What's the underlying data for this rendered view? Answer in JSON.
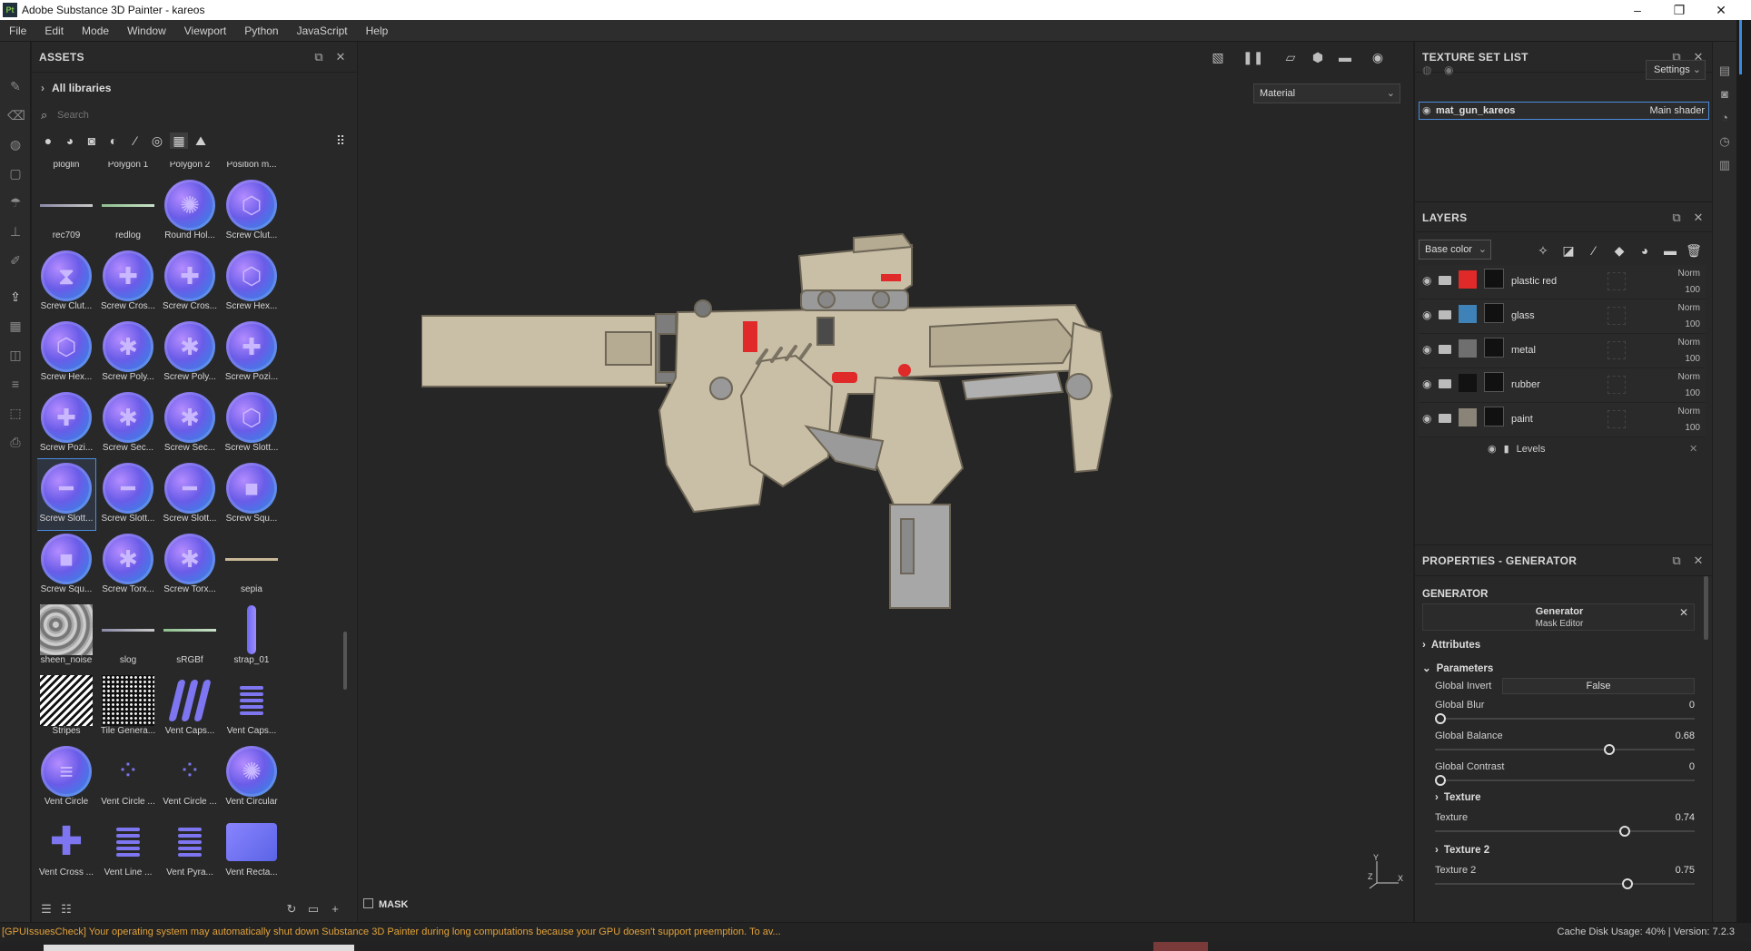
{
  "window": {
    "title": "Adobe Substance 3D Painter - kareos",
    "app_icon": "Pt"
  },
  "menu": [
    "File",
    "Edit",
    "Mode",
    "Window",
    "Viewport",
    "Python",
    "JavaScript",
    "Help"
  ],
  "assets": {
    "title": "ASSETS",
    "library": "All libraries",
    "search_placeholder": "Search",
    "items": [
      {
        "label": "ploglin",
        "thumb": "none"
      },
      {
        "label": "Polygon 1",
        "thumb": "none"
      },
      {
        "label": "Polygon 2",
        "thumb": "none"
      },
      {
        "label": "Position m...",
        "thumb": "none"
      },
      {
        "label": "rec709",
        "thumb": "line-gradient"
      },
      {
        "label": "redlog",
        "thumb": "line-green"
      },
      {
        "label": "Round Hol...",
        "thumb": "disc-gear"
      },
      {
        "label": "Screw Clut...",
        "thumb": "disc-hex"
      },
      {
        "label": "Screw Clut...",
        "thumb": "disc-clutch"
      },
      {
        "label": "Screw Cros...",
        "thumb": "disc-cross"
      },
      {
        "label": "Screw Cros...",
        "thumb": "disc-cross"
      },
      {
        "label": "Screw Hex...",
        "thumb": "disc-hex"
      },
      {
        "label": "Screw Hex...",
        "thumb": "disc-hex"
      },
      {
        "label": "Screw Poly...",
        "thumb": "disc-star"
      },
      {
        "label": "Screw Poly...",
        "thumb": "disc-star"
      },
      {
        "label": "Screw Pozi...",
        "thumb": "disc-cross"
      },
      {
        "label": "Screw Pozi...",
        "thumb": "disc-cross"
      },
      {
        "label": "Screw Sec...",
        "thumb": "disc-star"
      },
      {
        "label": "Screw Sec...",
        "thumb": "disc-star"
      },
      {
        "label": "Screw Slott...",
        "thumb": "disc-hex"
      },
      {
        "label": "Screw Slott...",
        "thumb": "disc-slot",
        "selected": true
      },
      {
        "label": "Screw Slott...",
        "thumb": "disc-slot"
      },
      {
        "label": "Screw Slott...",
        "thumb": "disc-slot"
      },
      {
        "label": "Screw Squ...",
        "thumb": "disc-square"
      },
      {
        "label": "Screw Squ...",
        "thumb": "disc-square"
      },
      {
        "label": "Screw Torx...",
        "thumb": "disc-star"
      },
      {
        "label": "Screw Torx...",
        "thumb": "disc-star"
      },
      {
        "label": "sepia",
        "thumb": "line-sepia"
      },
      {
        "label": "sheen_noise",
        "thumb": "noise"
      },
      {
        "label": "slog",
        "thumb": "line-gradient"
      },
      {
        "label": "sRGBf",
        "thumb": "line-green"
      },
      {
        "label": "strap_01",
        "thumb": "vbar"
      },
      {
        "label": "Stripes",
        "thumb": "stripes"
      },
      {
        "label": "Tile Genera...",
        "thumb": "tiles"
      },
      {
        "label": "Vent Caps...",
        "thumb": "vents"
      },
      {
        "label": "Vent Caps...",
        "thumb": "hlines"
      },
      {
        "label": "Vent Circle",
        "thumb": "disc-lines"
      },
      {
        "label": "Vent Circle ...",
        "thumb": "dots"
      },
      {
        "label": "Vent Circle ...",
        "thumb": "dots"
      },
      {
        "label": "Vent Circular",
        "thumb": "disc-gear"
      },
      {
        "label": "Vent Cross ...",
        "thumb": "cross"
      },
      {
        "label": "Vent Line ...",
        "thumb": "hlines"
      },
      {
        "label": "Vent Pyra...",
        "thumb": "hlines"
      },
      {
        "label": "Vent Recta...",
        "thumb": "rect"
      }
    ]
  },
  "viewport": {
    "material_mode": "Material",
    "mask_label": "MASK",
    "axis": {
      "y": "Y",
      "z": "Z",
      "x": "X"
    }
  },
  "texture_set_list": {
    "title": "TEXTURE SET LIST",
    "settings_label": "Settings",
    "sets": [
      {
        "name": "mat_gun_kareos",
        "shader": "Main shader"
      }
    ]
  },
  "layers": {
    "title": "LAYERS",
    "channel": "Base color",
    "rows": [
      {
        "name": "plastic red",
        "color": "#e02a2a",
        "mode": "Norm",
        "opacity": "100"
      },
      {
        "name": "glass",
        "color": "#3e82b8",
        "mode": "Norm",
        "opacity": "100"
      },
      {
        "name": "metal",
        "color": "#6f6f6f",
        "mode": "Norm",
        "opacity": "100"
      },
      {
        "name": "rubber",
        "color": "#121212",
        "mode": "Norm",
        "opacity": "100"
      },
      {
        "name": "paint",
        "color": "#8a8478",
        "mode": "Norm",
        "opacity": "100"
      }
    ],
    "effect_label": "Levels"
  },
  "properties": {
    "title": "PROPERTIES - GENERATOR",
    "section": "GENERATOR",
    "generator_name": "Generator",
    "generator_sub": "Mask Editor",
    "attributes_label": "Attributes",
    "parameters_label": "Parameters",
    "global_invert": {
      "label": "Global Invert",
      "value": "False"
    },
    "sliders": [
      {
        "label": "Global Blur",
        "value": "0",
        "fraction": 0.0
      },
      {
        "label": "Global Balance",
        "value": "0.68",
        "fraction": 0.68
      },
      {
        "label": "Global Contrast",
        "value": "0",
        "fraction": 0.0
      }
    ],
    "texture_section": "Texture",
    "texture": {
      "label": "Texture",
      "value": "0.74",
      "fraction": 0.74
    },
    "texture2_section": "Texture 2",
    "texture2": {
      "label": "Texture 2",
      "value": "0.75",
      "fraction": 0.75
    }
  },
  "status": {
    "message": "[GPUIssuesCheck] Your operating system may automatically shut down Substance 3D Painter during long computations because your GPU doesn't support preemption. To av...",
    "cache": "Cache Disk Usage:  40% | Version: 7.2.3"
  },
  "colors": {
    "accent": "#4a8de0",
    "warning": "#e2a23a",
    "gun_body": "#c9bea6",
    "gun_red": "#e02a2a"
  }
}
